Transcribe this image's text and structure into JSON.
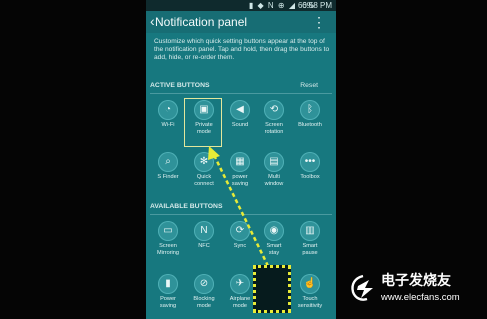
{
  "status_bar": {
    "icons": "▮ ◆ N ⊕ ◢",
    "battery": "60%",
    "time": "6:58 PM"
  },
  "header": {
    "title": "Notification panel"
  },
  "description": "Customize which quick setting buttons appear at the top of the notification panel. Tap and hold, then drag the buttons to add, hide, or re-order them.",
  "active_section": {
    "title": "ACTIVE BUTTONS",
    "reset_label": "Reset"
  },
  "active_buttons": [
    {
      "label": "Wi-Fi",
      "icon": "wifi-icon",
      "glyph": "◔"
    },
    {
      "label": "Private\nmode",
      "icon": "private-mode-icon",
      "glyph": "▣"
    },
    {
      "label": "Sound",
      "icon": "sound-icon",
      "glyph": "◀"
    },
    {
      "label": "Screen\nrotation",
      "icon": "screen-rotation-icon",
      "glyph": "⟲"
    },
    {
      "label": "Bluetooth",
      "icon": "bluetooth-icon",
      "glyph": "ᛒ"
    },
    {
      "label": "S Finder",
      "icon": "s-finder-icon",
      "glyph": "⌕"
    },
    {
      "label": "Quick\nconnect",
      "icon": "quick-connect-icon",
      "glyph": "✻"
    },
    {
      "label": "power\nsaving",
      "icon": "power-saving-icon",
      "glyph": "▦"
    },
    {
      "label": "Multi\nwindow",
      "icon": "multi-window-icon",
      "glyph": "▤"
    },
    {
      "label": "Toolbox",
      "icon": "toolbox-icon",
      "glyph": "•••"
    }
  ],
  "available_section": {
    "title": "AVAILABLE BUTTONS"
  },
  "available_buttons": [
    {
      "label": "Screen\nMirroring",
      "icon": "screen-mirroring-icon",
      "glyph": "▭"
    },
    {
      "label": "NFC",
      "icon": "nfc-icon",
      "glyph": "N"
    },
    {
      "label": "Sync",
      "icon": "sync-icon",
      "glyph": "⟳"
    },
    {
      "label": "Smart\nstay",
      "icon": "smart-stay-icon",
      "glyph": "◉"
    },
    {
      "label": "Smart\npause",
      "icon": "smart-pause-icon",
      "glyph": "▥"
    },
    {
      "label": "Power\nsaving",
      "icon": "power-saving-available-icon",
      "glyph": "▮"
    },
    {
      "label": "Blocking\nmode",
      "icon": "blocking-mode-icon",
      "glyph": "⊘"
    },
    {
      "label": "Airplane\nmode",
      "icon": "airplane-mode-icon",
      "glyph": "✈"
    },
    {
      "label": "",
      "icon": "",
      "glyph": ""
    },
    {
      "label": "Touch\nsensitivity",
      "icon": "touch-sensitivity-icon",
      "glyph": "☝"
    }
  ],
  "watermark": {
    "chinese": "电子发烧友",
    "english": "www.elecfans.com"
  },
  "colors": {
    "panel_bg": "#17787f",
    "tile_bg": "#2f9299",
    "highlight": "#e7eb37"
  }
}
